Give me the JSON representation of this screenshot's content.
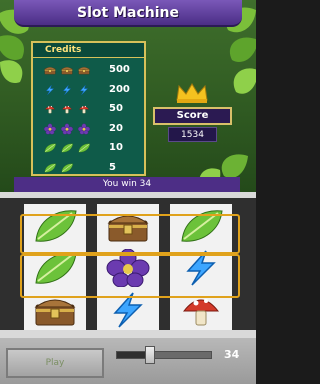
{
  "game": {
    "title": "Slot Machine"
  },
  "credits": {
    "header": "Credits",
    "rows": [
      {
        "symbol": "treasure-chest",
        "count": 3,
        "value": "500"
      },
      {
        "symbol": "lightning-bolt",
        "count": 3,
        "value": "200"
      },
      {
        "symbol": "mushroom",
        "count": 3,
        "value": "50"
      },
      {
        "symbol": "purple-flower",
        "count": 3,
        "value": "20"
      },
      {
        "symbol": "leaf",
        "count": 3,
        "value": "10"
      },
      {
        "symbol": "leaf",
        "count": 2,
        "value": "5"
      }
    ]
  },
  "score": {
    "label": "Score",
    "value": "1534"
  },
  "win_message": "You win 34",
  "reels": [
    [
      "leaf",
      "leaf",
      "treasure-chest"
    ],
    [
      "treasure-chest",
      "purple-flower",
      "lightning-bolt"
    ],
    [
      "leaf",
      "lightning-bolt",
      "mushroom"
    ]
  ],
  "controls": {
    "spin_label": "Play",
    "bet_value": "34",
    "bet_fraction": 0.35
  },
  "colors": {
    "accent": "#e0a21c",
    "title_purple": "#5a3a9a",
    "panel_green": "#0f5b49"
  }
}
